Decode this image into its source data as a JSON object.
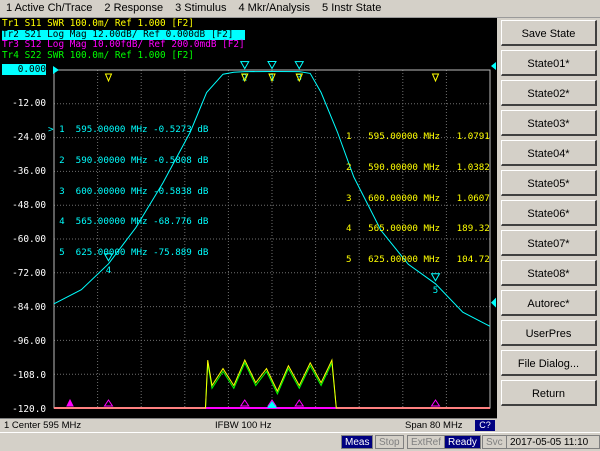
{
  "menu": [
    "1 Active Ch/Trace",
    "2 Response",
    "3 Stimulus",
    "4 Mkr/Analysis",
    "5 Instr State"
  ],
  "traces": [
    {
      "text": "Tr1 S11 SWR 100.0m/ Ref 1.000 [F2]",
      "color": "#ffff00",
      "active": false
    },
    {
      "text": "Tr2 S21 Log Mag 12.00dB/ Ref 0.000dB [F2]",
      "color": "#00ffff",
      "active": true
    },
    {
      "text": "Tr3 S12 Log Mag 10.00fdB/ Ref 200.0mdB [F2]",
      "color": "#ff00ff",
      "active": false
    },
    {
      "text": "Tr4 S22 SWR 100.0m/ Ref 1.000 [F2]",
      "color": "#00ff00",
      "active": false
    }
  ],
  "y_labels": [
    "0.000",
    "-12.00",
    "-24.00",
    "-36.00",
    "-48.00",
    "-60.00",
    "-72.00",
    "-84.00",
    "-96.00",
    "-108.0",
    "-120.0"
  ],
  "marker_table_s21": [
    "> 1  595.00000 MHz -0.5273 dB",
    "  2  590.00000 MHz -0.5808 dB",
    "  3  600.00000 MHz -0.5838 dB",
    "  4  565.00000 MHz -68.776 dB",
    "  5  625.00000 MHz -75.889 dB"
  ],
  "marker_table_swr": [
    "1   595.00000 MHz   1.0791",
    "2   590.00000 MHz   1.0382",
    "3   600.00000 MHz   1.0607",
    "4   565.00000 MHz   189.32",
    "5   625.00000 MHz   104.72"
  ],
  "status": {
    "left": "1  Center 595 MHz",
    "center": "IFBW 100 Hz",
    "right": "Span 80 MHz",
    "channel": "C?"
  },
  "taskbar": {
    "meas": "Meas",
    "stop": "Stop",
    "extref": "ExtRef",
    "ready": "Ready",
    "svc": "Svc",
    "datetime": "2017-05-05 11:10"
  },
  "softkeys": [
    {
      "label": "Save State",
      "style": "title"
    },
    {
      "label": "State01*",
      "style": "normal"
    },
    {
      "label": "State02*",
      "style": "selected"
    },
    {
      "label": "State03*",
      "style": "normal"
    },
    {
      "label": "State04*",
      "style": "normal"
    },
    {
      "label": "State05*",
      "style": "normal"
    },
    {
      "label": "State06*",
      "style": "normal"
    },
    {
      "label": "State07*",
      "style": "normal"
    },
    {
      "label": "State08*",
      "style": "normal"
    },
    {
      "label": "Autorec*",
      "style": "normal"
    },
    {
      "label": "UserPres",
      "style": "normal"
    },
    {
      "label": "File Dialog...",
      "style": "normal"
    },
    {
      "label": "Return",
      "style": "normal"
    }
  ],
  "marker_labels": [
    "1",
    "2",
    "3",
    "4",
    "5"
  ],
  "colors": {
    "s11": "#ffff00",
    "s21": "#00ffff",
    "s12": "#ff00ff",
    "s22": "#00ff00",
    "grid": "#6f6f6f"
  },
  "chart_data": {
    "type": "line",
    "x_unit": "MHz",
    "xlim": [
      555,
      635
    ],
    "ylim": [
      -120,
      0
    ],
    "y_labels_dB": [
      0,
      -12,
      -24,
      -36,
      -48,
      -60,
      -72,
      -84,
      -96,
      -108,
      -120
    ],
    "series": [
      {
        "name": "S21",
        "x": [
          555,
          560,
          565,
          570,
          575,
          580,
          583,
          586,
          588,
          590,
          595,
          600,
          602,
          604,
          607,
          610,
          615,
          620,
          625,
          630,
          635
        ],
        "y": [
          -83,
          -78,
          -68.8,
          -56,
          -40,
          -22,
          -8,
          -1.5,
          -0.8,
          -0.58,
          -0.53,
          -0.58,
          -1.2,
          -8,
          -22,
          -38,
          -57,
          -69,
          -75.9,
          -86,
          -91
        ]
      },
      {
        "name": "S11",
        "x": [
          555,
          582.8,
          583.2,
          584,
          586,
          588,
          590,
          592,
          594,
          596,
          598,
          600,
          602,
          604,
          606,
          606.8,
          607.2,
          635
        ],
        "y": [
          -120,
          -120,
          -103,
          -112,
          -106,
          -112,
          -103,
          -111,
          -106,
          -114,
          -105,
          -112,
          -104,
          -111,
          -103,
          -120,
          -120,
          -120
        ]
      },
      {
        "name": "S22",
        "x": [
          555,
          582.8,
          583.2,
          584,
          586,
          588,
          590,
          592,
          594,
          596,
          598,
          600,
          602,
          604,
          606,
          606.8,
          607.2,
          635
        ],
        "y": [
          -120,
          -120,
          -104,
          -113,
          -107,
          -113,
          -104,
          -112,
          -107,
          -115,
          -106,
          -113,
          -105,
          -112,
          -104,
          -120,
          -120,
          -120
        ]
      },
      {
        "name": "S12",
        "x": [
          555,
          635
        ],
        "y": [
          -120,
          -120
        ]
      }
    ]
  }
}
